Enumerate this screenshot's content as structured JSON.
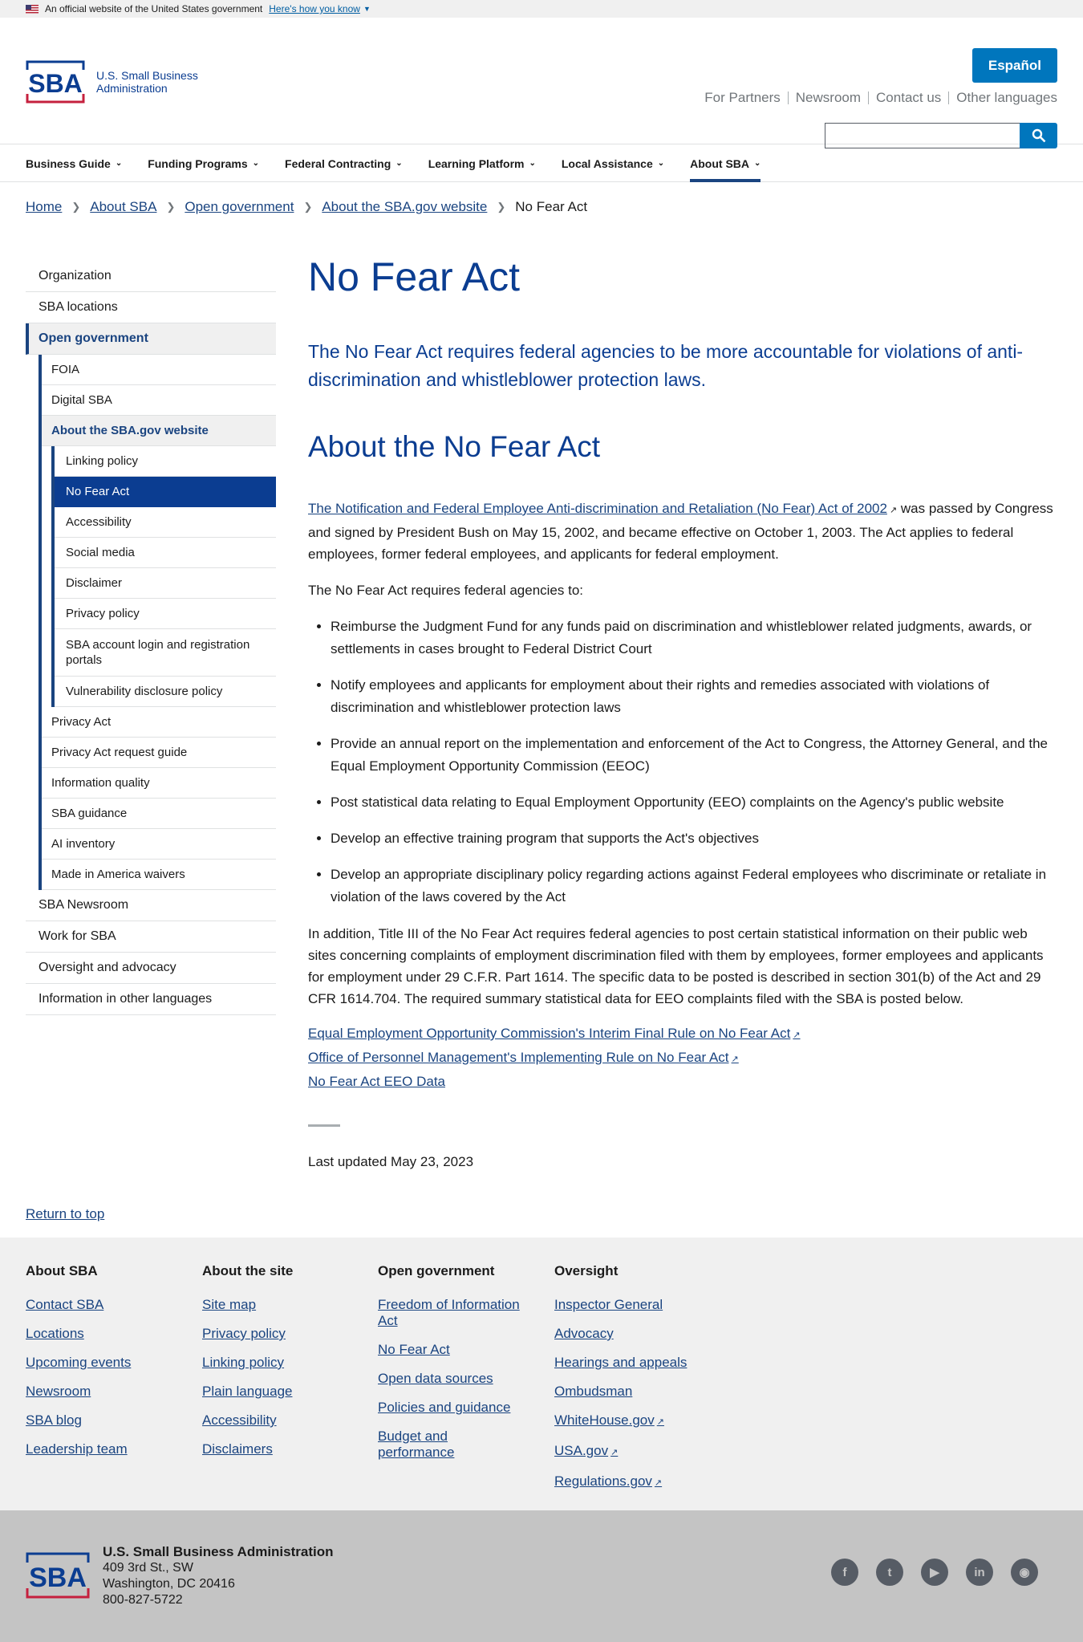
{
  "gov_banner": {
    "text": "An official website of the United States government",
    "link": "Here's how you know"
  },
  "header": {
    "logo_line1": "U.S. Small Business",
    "logo_line2": "Administration",
    "espanol": "Español",
    "util_links": [
      "For Partners",
      "Newsroom",
      "Contact us",
      "Other languages"
    ],
    "search_placeholder": ""
  },
  "nav": {
    "items": [
      "Business Guide",
      "Funding Programs",
      "Federal Contracting",
      "Learning Platform",
      "Local Assistance",
      "About SBA"
    ],
    "active": "About SBA"
  },
  "breadcrumb": [
    "Home",
    "About SBA",
    "Open government",
    "About the SBA.gov website",
    "No Fear Act"
  ],
  "sidenav": {
    "top": [
      "Organization",
      "SBA locations"
    ],
    "current": "Open government",
    "sub_before": [
      "FOIA",
      "Digital SBA"
    ],
    "sub_current": "About the SBA.gov website",
    "sub2": [
      "Linking policy",
      "No Fear Act",
      "Accessibility",
      "Social media",
      "Disclaimer",
      "Privacy policy",
      "SBA account login and registration portals",
      "Vulnerability disclosure policy"
    ],
    "sub_after": [
      "Privacy Act",
      "Privacy Act request guide",
      "Information quality",
      "SBA guidance",
      "AI inventory",
      "Made in America waivers"
    ],
    "bottom": [
      "SBA Newsroom",
      "Work for SBA",
      "Oversight and advocacy",
      "Information in other languages"
    ]
  },
  "content": {
    "title": "No Fear Act",
    "lead": "The No Fear Act requires federal agencies to be more accountable for violations of anti-discrimination and whistleblower protection laws.",
    "h2": "About the No Fear Act",
    "p1_link": "The Notification and Federal Employee Anti-discrimination and Retaliation (No Fear) Act of 2002",
    "p1_text": " was passed by Congress and signed by President Bush on May 15, 2002, and became effective on October 1, 2003. The Act applies to federal employees, former federal employees, and applicants for federal employment.",
    "p2": "The No Fear Act requires federal agencies to:",
    "bullets": [
      "Reimburse the Judgment Fund for any funds paid on discrimination and whistleblower related judgments, awards, or settlements in cases brought to Federal District Court",
      "Notify employees and applicants for employment about their rights and remedies associated with violations of discrimination and whistleblower protection laws",
      "Provide an annual report on the implementation and enforcement of the Act to Congress, the Attorney General, and the Equal Employment Opportunity Commission (EEOC)",
      "Post statistical data relating to Equal Employment Opportunity (EEO) complaints on the Agency's public website",
      "Develop an effective training program that supports the Act's objectives",
      "Develop an appropriate disciplinary policy regarding actions against Federal employees who discriminate or retaliate in violation of the laws covered by the Act"
    ],
    "p3": "In addition, Title III of the No Fear Act requires federal agencies to post certain statistical information on their public web sites concerning complaints of employment discrimination filed with them by employees, former employees and applicants for employment under 29 C.F.R. Part 1614. The specific data to be posted is described in section 301(b) of the Act and 29 CFR 1614.704. The required summary statistical data for EEO complaints filed with the SBA is posted below.",
    "links": [
      "Equal Employment Opportunity Commission's Interim Final Rule on No Fear Act",
      "Office of Personnel Management's Implementing Rule on No Fear Act",
      "No Fear Act EEO Data"
    ],
    "updated": "Last updated May 23, 2023"
  },
  "return_top": "Return to top",
  "footer": {
    "columns": [
      {
        "heading": "About SBA",
        "links": [
          "Contact SBA",
          "Locations",
          "Upcoming events",
          "Newsroom",
          "SBA blog",
          "Leadership team"
        ]
      },
      {
        "heading": "About the site",
        "links": [
          "Site map",
          "Privacy policy",
          "Linking policy",
          "Plain language",
          "Accessibility",
          "Disclaimers"
        ]
      },
      {
        "heading": "Open government",
        "links": [
          "Freedom of Information Act",
          "No Fear Act",
          "Open data sources",
          "Policies and guidance",
          "Budget and performance"
        ]
      },
      {
        "heading": "Oversight",
        "links": [
          "Inspector General",
          "Advocacy",
          "Hearings and appeals",
          "Ombudsman",
          "WhiteHouse.gov",
          "USA.gov",
          "Regulations.gov"
        ]
      }
    ],
    "org_name": "U.S. Small Business Administration",
    "address1": "409 3rd St., SW",
    "address2": "Washington, DC 20416",
    "phone": "800-827-5722",
    "social": [
      "facebook-icon",
      "twitter-icon",
      "youtube-icon",
      "linkedin-icon",
      "instagram-icon"
    ]
  }
}
